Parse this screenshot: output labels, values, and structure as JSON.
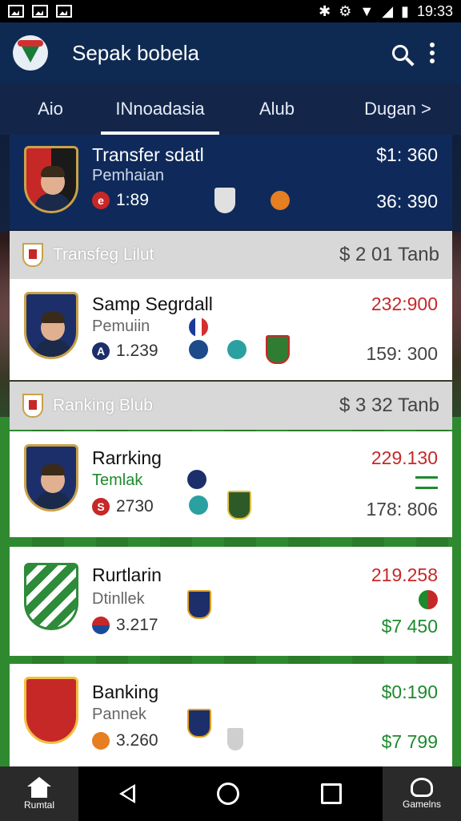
{
  "status_bar": {
    "time": "19:33"
  },
  "app_bar": {
    "title": "Sepak bobela"
  },
  "tabs": [
    {
      "label": "Aio",
      "active": false
    },
    {
      "label": "INnoadasia",
      "active": true
    },
    {
      "label": "Alub",
      "active": false
    },
    {
      "label": "Dugan >",
      "active": false
    }
  ],
  "featured": {
    "name": "Transfer sdatl",
    "sub": "Pemhaian",
    "stat": "1:89",
    "value_top": "$1: 360",
    "value_bottom": "36: 390"
  },
  "sections": [
    {
      "title": "Transfeg Lilut",
      "amount": "$ 2 01 Tanb"
    },
    {
      "title": "Ranking Blub",
      "amount": "$ 3 32 Tanb"
    }
  ],
  "rows": [
    {
      "name": "Samp Segrdall",
      "sub": "Pemuiin",
      "stat": "1.239",
      "value_top": "232:900",
      "value_bottom": "159: 300"
    },
    {
      "name": "Rarrking",
      "sub": "Temlak",
      "stat": "2730",
      "value_top": "229.130",
      "value_bottom": "178: 806"
    },
    {
      "name": "Rurtlarin",
      "sub": "Dtinllek",
      "stat": "3.217",
      "value_top": "219.258",
      "value_bottom": "$7 450"
    },
    {
      "name": "Banking",
      "sub": "Pannek",
      "stat": "3.260",
      "value_top": "$0:190",
      "value_bottom": "$7 799"
    }
  ],
  "nav": {
    "home_label": "Rumtal",
    "games_label": "Gamelns"
  },
  "colors": {
    "appbar": "#0f2a52",
    "featured": "#0f2a5a",
    "negative": "#c62828",
    "positive": "#1e8a2e"
  }
}
